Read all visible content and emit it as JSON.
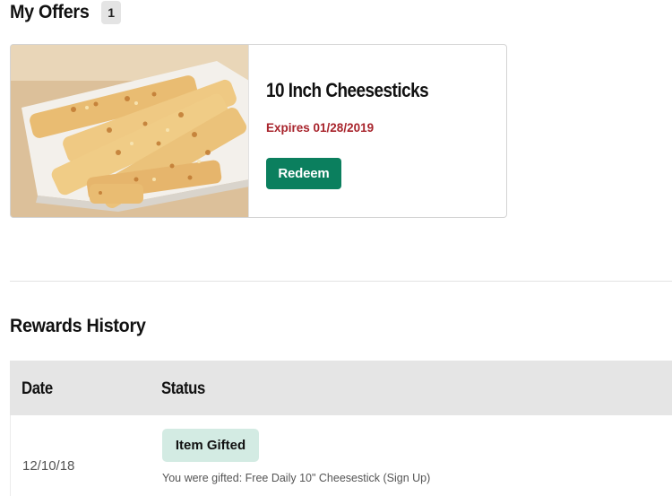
{
  "offers": {
    "title": "My Offers",
    "count": "1",
    "items": [
      {
        "name": "10 Inch Cheesesticks",
        "expiry": "Expires 01/28/2019",
        "redeem_label": "Redeem",
        "image": "cheesesticks-photo"
      }
    ]
  },
  "rewards": {
    "title": "Rewards History",
    "columns": [
      "Date",
      "Status"
    ],
    "rows": [
      {
        "date": "12/10/18",
        "status": "Item Gifted",
        "description": "You were gifted: Free Daily 10\" Cheesestick (Sign Up)"
      }
    ]
  },
  "colors": {
    "accent_green": "#0b7f5e",
    "expiry_red": "#a8242c",
    "badge_bg": "#d3ebe3",
    "table_header_bg": "#e5e5e5"
  }
}
